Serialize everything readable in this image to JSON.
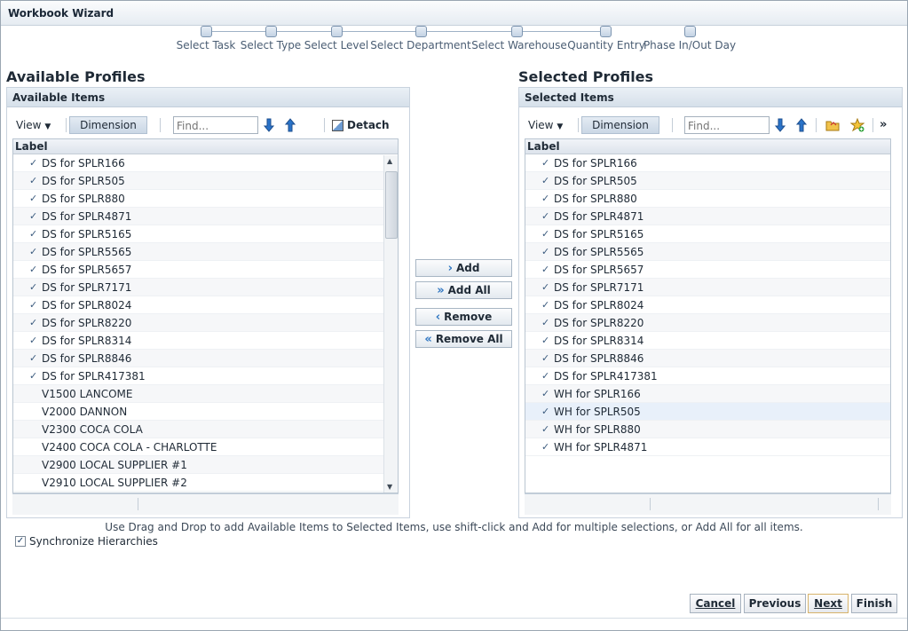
{
  "window": {
    "title": "Workbook Wizard"
  },
  "train": {
    "steps": [
      "Select Task",
      "Select Type",
      "Select Level",
      "Select Department",
      "Select Warehouse",
      "Quantity Entry",
      "Phase In/Out Day"
    ]
  },
  "available": {
    "section_title": "Available Profiles",
    "panel_title": "Available Items",
    "toolbar": {
      "view_label": "View",
      "dimension_label": "Dimension",
      "find_placeholder": "Find...",
      "detach_label": "Detach"
    },
    "column_label": "Label",
    "rows": [
      {
        "label": "DS for SPLR166",
        "checked": true
      },
      {
        "label": "DS for SPLR505",
        "checked": true
      },
      {
        "label": "DS for SPLR880",
        "checked": true
      },
      {
        "label": "DS for SPLR4871",
        "checked": true
      },
      {
        "label": "DS for SPLR5165",
        "checked": true
      },
      {
        "label": "DS for SPLR5565",
        "checked": true
      },
      {
        "label": "DS for SPLR5657",
        "checked": true
      },
      {
        "label": "DS for SPLR7171",
        "checked": true
      },
      {
        "label": "DS for SPLR8024",
        "checked": true
      },
      {
        "label": "DS for SPLR8220",
        "checked": true
      },
      {
        "label": "DS for SPLR8314",
        "checked": true
      },
      {
        "label": "DS for SPLR8846",
        "checked": true
      },
      {
        "label": "DS for SPLR417381",
        "checked": true
      },
      {
        "label": "V1500 LANCOME",
        "checked": false
      },
      {
        "label": "V2000 DANNON",
        "checked": false
      },
      {
        "label": "V2300 COCA COLA",
        "checked": false
      },
      {
        "label": "V2400 COCA COLA - CHARLOTTE",
        "checked": false
      },
      {
        "label": "V2900 LOCAL SUPPLIER #1",
        "checked": false
      },
      {
        "label": "V2910 LOCAL SUPPLIER #2",
        "checked": false
      }
    ]
  },
  "actions": {
    "add": "Add",
    "add_all": "Add All",
    "remove": "Remove",
    "remove_all": "Remove All"
  },
  "selected": {
    "section_title": "Selected Profiles",
    "panel_title": "Selected Items",
    "toolbar": {
      "view_label": "View",
      "dimension_label": "Dimension",
      "find_placeholder": "Find...",
      "more_label": "»"
    },
    "column_label": "Label",
    "rows": [
      {
        "label": "DS for SPLR166",
        "checked": true
      },
      {
        "label": "DS for SPLR505",
        "checked": true
      },
      {
        "label": "DS for SPLR880",
        "checked": true
      },
      {
        "label": "DS for SPLR4871",
        "checked": true
      },
      {
        "label": "DS for SPLR5165",
        "checked": true
      },
      {
        "label": "DS for SPLR5565",
        "checked": true
      },
      {
        "label": "DS for SPLR5657",
        "checked": true
      },
      {
        "label": "DS for SPLR7171",
        "checked": true
      },
      {
        "label": "DS for SPLR8024",
        "checked": true
      },
      {
        "label": "DS for SPLR8220",
        "checked": true
      },
      {
        "label": "DS for SPLR8314",
        "checked": true
      },
      {
        "label": "DS for SPLR8846",
        "checked": true
      },
      {
        "label": "DS for SPLR417381",
        "checked": true
      },
      {
        "label": "WH for SPLR166",
        "checked": true
      },
      {
        "label": "WH for SPLR505",
        "checked": true,
        "highlight": true
      },
      {
        "label": "WH for SPLR880",
        "checked": true
      },
      {
        "label": "WH for SPLR4871",
        "checked": true
      }
    ]
  },
  "hint": "Use Drag and Drop to add Available Items to Selected Items, use shift-click and Add for multiple selections, or Add All for all items.",
  "sync": {
    "label": "Synchronize Hierarchies",
    "checked": true
  },
  "buttons": {
    "cancel": "Cancel",
    "previous": "Previous",
    "next": "Next",
    "finish": "Finish"
  },
  "colors": {
    "accent": "#2f76c2",
    "header": "#d6e0ea",
    "check": "#3b5b7e"
  }
}
